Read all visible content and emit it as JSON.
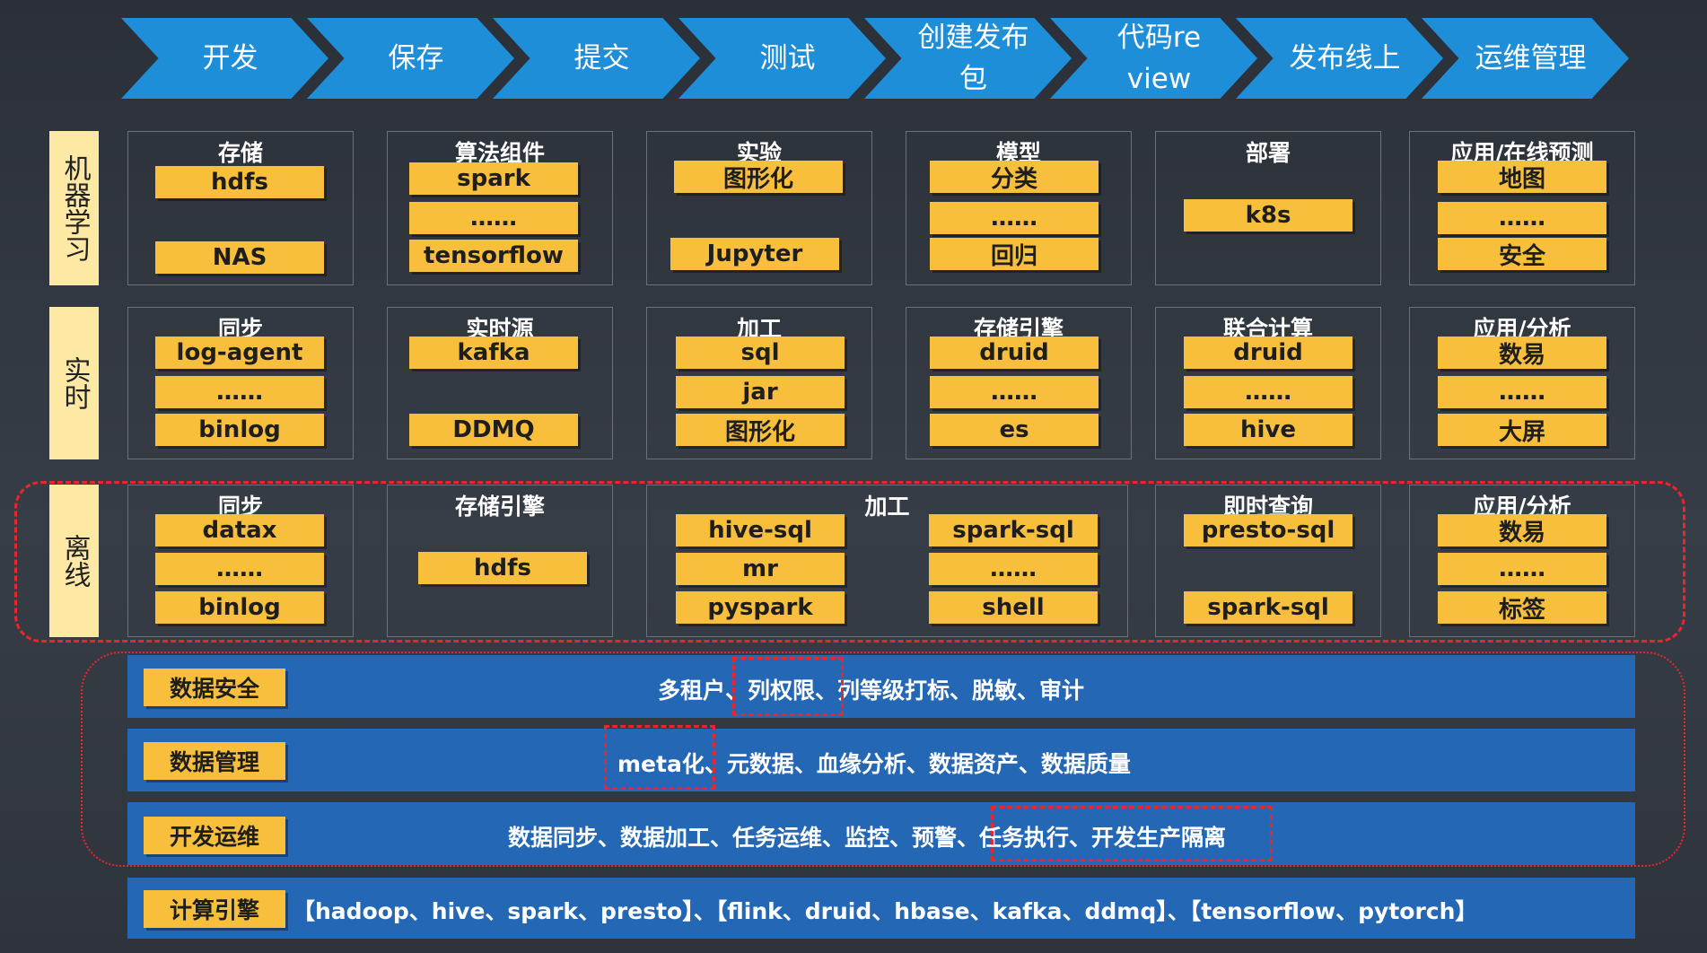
{
  "pipeline": [
    "开发",
    "保存",
    "提交",
    "测试",
    "创建发布包",
    "代码review",
    "发布线上",
    "运维管理"
  ],
  "rows": {
    "ml": {
      "label": "机器学习",
      "cells": [
        {
          "title": "存储",
          "items": [
            "hdfs",
            "NAS"
          ]
        },
        {
          "title": "算法组件",
          "items": [
            "spark",
            "……",
            "tensorflow"
          ]
        },
        {
          "title": "实验",
          "items": [
            "图形化",
            "Jupyter"
          ]
        },
        {
          "title": "模型",
          "items": [
            "分类",
            "……",
            "回归"
          ]
        },
        {
          "title": "部署",
          "items": [
            "k8s"
          ]
        },
        {
          "title": "应用/在线预测",
          "items": [
            "地图",
            "……",
            "安全"
          ]
        }
      ]
    },
    "realtime": {
      "label": "实时",
      "cells": [
        {
          "title": "同步",
          "items": [
            "log-agent",
            "……",
            "binlog"
          ]
        },
        {
          "title": "实时源",
          "items": [
            "kafka",
            "DDMQ"
          ]
        },
        {
          "title": "加工",
          "items": [
            "sql",
            "jar",
            "图形化"
          ]
        },
        {
          "title": "存储引擎",
          "items": [
            "druid",
            "……",
            "es"
          ]
        },
        {
          "title": "联合计算",
          "items": [
            "druid",
            "……",
            "hive"
          ]
        },
        {
          "title": "应用/分析",
          "items": [
            "数易",
            "……",
            "大屏"
          ]
        }
      ]
    },
    "offline": {
      "label": "离线",
      "cells": [
        {
          "title": "同步",
          "items": [
            "datax",
            "……",
            "binlog"
          ]
        },
        {
          "title": "存储引擎",
          "items": [
            "hdfs"
          ]
        },
        {
          "title": "加工",
          "items_left": [
            "hive-sql",
            "mr",
            "pyspark"
          ],
          "items_right": [
            "spark-sql",
            "……",
            "shell"
          ]
        },
        {
          "title": "即时查询",
          "items": [
            "presto-sql",
            "spark-sql"
          ]
        },
        {
          "title": "应用/分析",
          "items": [
            "数易",
            "……",
            "标签"
          ]
        }
      ]
    }
  },
  "bands": {
    "security": {
      "label": "数据安全",
      "pre": "多租户、",
      "highlight": "列权限、",
      "post": "列等级打标、脱敏、审计"
    },
    "management": {
      "label": "数据管理",
      "highlight": "meta化、",
      "post": "元数据、血缘分析、数据资产、数据质量"
    },
    "devops": {
      "label": "开发运维",
      "pre": "数据同步、数据加工、任务运维、监控、预警、",
      "highlight": "任务执行、开发生产隔离"
    },
    "engine": {
      "label": "计算引擎",
      "text": "【hadoop、hive、spark、presto】、【flink、druid、hbase、kafka、ddmq】、【tensorflow、pytorch】"
    }
  },
  "colors": {
    "arrow": "#1f8ed8",
    "chip": "#f7bf3b",
    "row_label": "#fde8a4",
    "band": "#2467b5",
    "highlight_border": "#e8262b",
    "background": "#30353d"
  }
}
